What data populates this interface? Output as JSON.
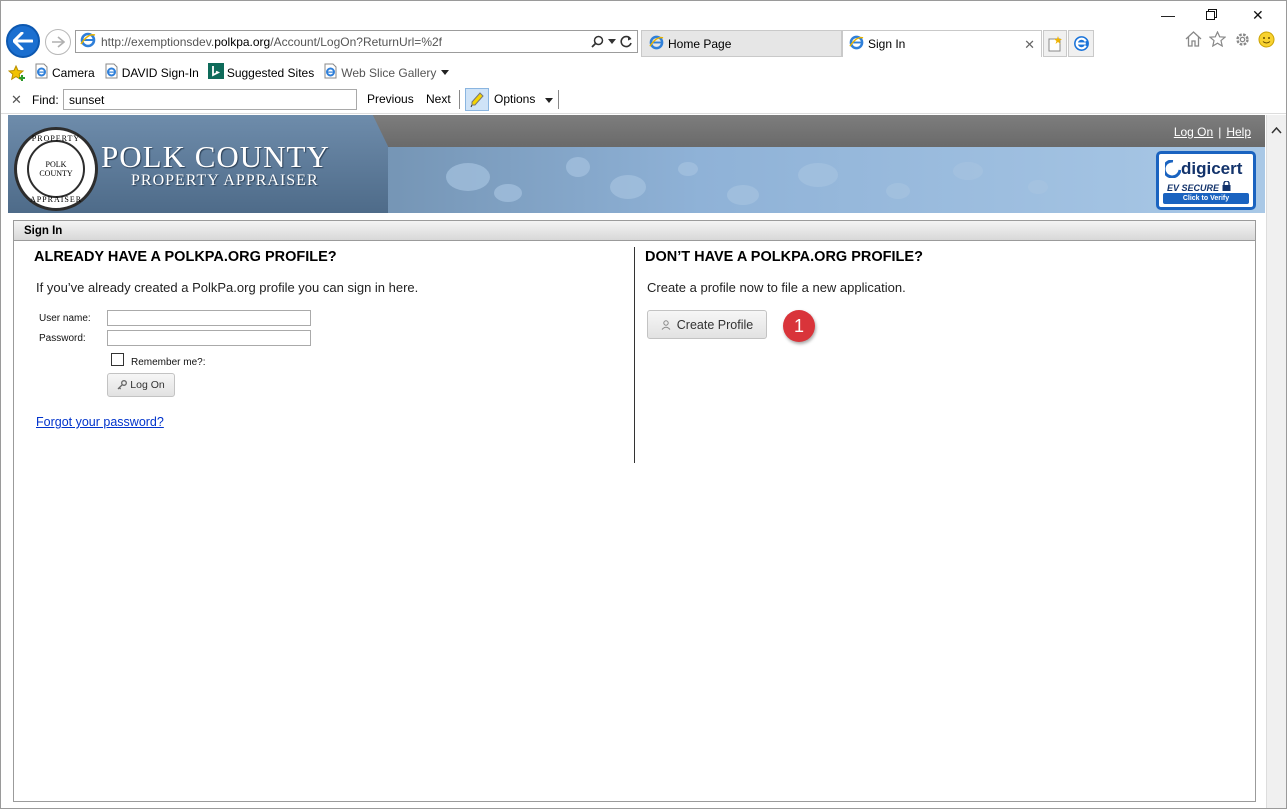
{
  "browser": {
    "address_prefix": "http://exemptionsdev.",
    "address_domain": "polkpa.org",
    "address_suffix": "/Account/LogOn?ReturnUrl=%2f",
    "tabs": [
      {
        "label": "Home Page"
      },
      {
        "label": "Sign In"
      }
    ]
  },
  "favorites": [
    {
      "label": "Camera",
      "icon": "ie-page-icon"
    },
    {
      "label": "DAVID Sign-In",
      "icon": "ie-page-icon"
    },
    {
      "label": "Suggested Sites",
      "icon": "bing-icon"
    },
    {
      "label": "Web Slice Gallery",
      "icon": "ie-page-icon"
    }
  ],
  "findbar": {
    "label": "Find:",
    "value": "sunset",
    "previous": "Previous",
    "next": "Next",
    "options": "Options"
  },
  "site": {
    "title": "POLK COUNTY",
    "subtitle": "PROPERTY APPRAISER",
    "seal_top": "PROPERTY",
    "seal_center": "POLK COUNTY",
    "seal_bottom": "APPRAISER",
    "links": {
      "logon": "Log On",
      "help": "Help",
      "separator": "|"
    },
    "digicert": {
      "brand": "digicert",
      "ev": "EV SECURE",
      "verify": "Click to Verify"
    }
  },
  "signin": {
    "header": "Sign In",
    "left": {
      "title": "ALREADY HAVE A POLKPA.ORG PROFILE?",
      "text": "If you’ve already created a PolkPa.org profile you can sign in here.",
      "username_label": "User name:",
      "password_label": "Password:",
      "remember_label": "Remember me?:",
      "logon_button": "Log On",
      "forgot_link": "Forgot your password?"
    },
    "right": {
      "title": "DON’T HAVE A POLKPA.ORG PROFILE?",
      "text": "Create a profile now to file a new application.",
      "create_button": "Create Profile",
      "callout": "1"
    }
  },
  "colors": {
    "accent": "#1b6fd0",
    "callout": "#d9343a",
    "link": "#0033cc"
  }
}
